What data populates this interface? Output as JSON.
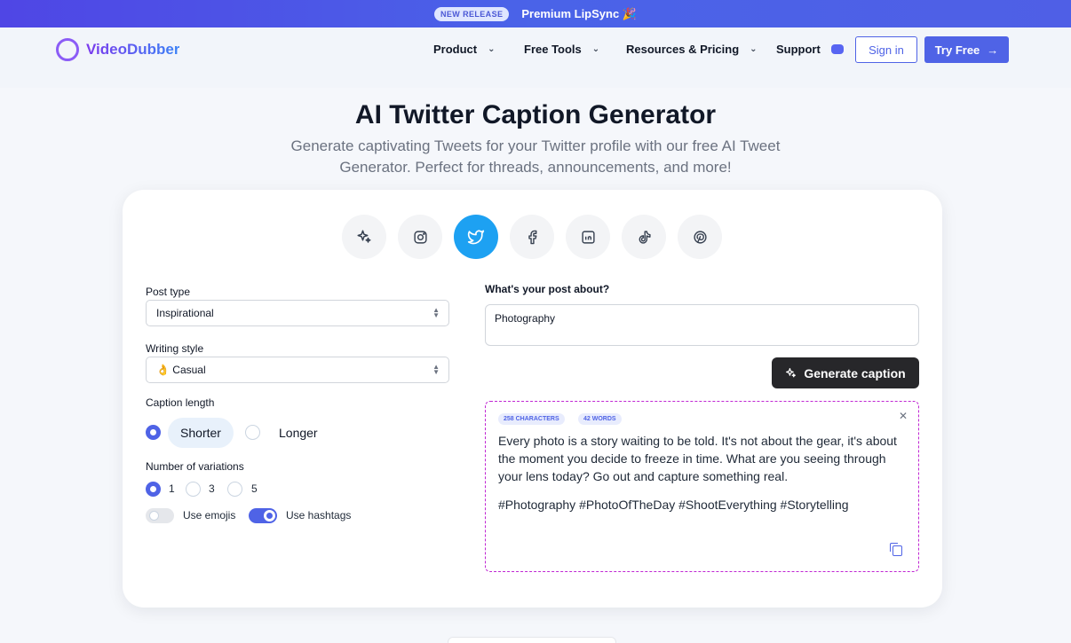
{
  "announcement": {
    "badge": "NEW RELEASE",
    "text": "Premium LipSync 🎉"
  },
  "nav": {
    "brand": "VideoDubber",
    "items": [
      {
        "label": "Product",
        "icon": "chevron-down-icon"
      },
      {
        "label": "Free Tools",
        "icon": "chevron-down-icon"
      },
      {
        "label": "Resources & Pricing",
        "icon": "chevron-down-icon"
      },
      {
        "label": "Support",
        "icon": "discord-icon"
      }
    ],
    "signin": "Sign in",
    "try_free": "Try Free"
  },
  "hero": {
    "title": "AI Twitter Caption Generator",
    "subtitle": "Generate captivating Tweets for your Twitter profile with our free AI Tweet Generator. Perfect for threads, announcements, and more!"
  },
  "platforms": [
    {
      "name": "sparkles-icon",
      "active": false
    },
    {
      "name": "instagram-icon",
      "active": false
    },
    {
      "name": "twitter-icon",
      "active": true
    },
    {
      "name": "facebook-icon",
      "active": false
    },
    {
      "name": "linkedin-icon",
      "active": false
    },
    {
      "name": "tiktok-icon",
      "active": false
    },
    {
      "name": "pinterest-icon",
      "active": false
    }
  ],
  "form": {
    "post_type_label": "Post type",
    "post_type_value": "Inspirational",
    "writing_style_label": "Writing style",
    "writing_style_value": "👌 Casual",
    "caption_length_label": "Caption length",
    "length_options": [
      "Shorter",
      "Longer"
    ],
    "length_selected": "Shorter",
    "variations_label": "Number of variations",
    "variation_options": [
      "1",
      "3",
      "5"
    ],
    "variation_selected": "1",
    "use_emojis_label": "Use emojis",
    "use_emojis": false,
    "use_hashtags_label": "Use hashtags",
    "use_hashtags": true
  },
  "post": {
    "label": "What's your post about?",
    "value": "Photography",
    "generate_label": "Generate caption"
  },
  "result": {
    "characters": "258 CHARACTERS",
    "words": "42 WORDS",
    "caption": "Every photo is a story waiting to be told. It's not about the gear, it's about the moment you decide to freeze in time. What are you seeing through your lens today? Go out and capture something real.",
    "hashtags": "#Photography #PhotoOfTheDay #ShootEverything #Storytelling"
  },
  "colors": {
    "accent": "#4f63e6",
    "twitter": "#1da1f2",
    "dark_button": "#27272a",
    "result_border": "#c026d3"
  }
}
